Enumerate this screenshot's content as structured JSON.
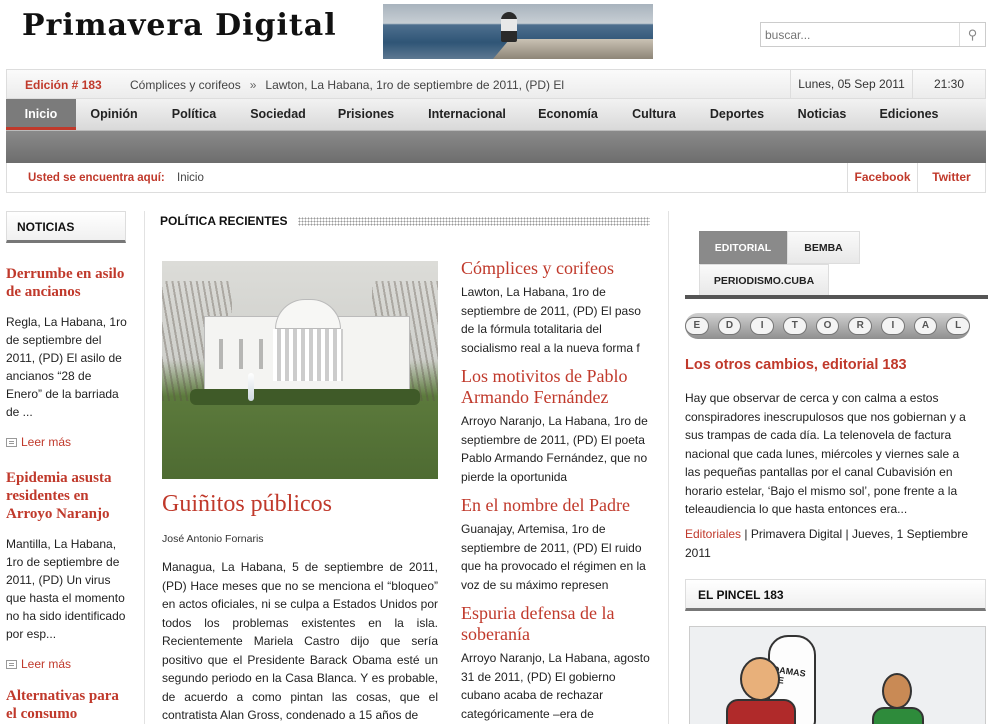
{
  "header": {
    "logo": "Primavera Digital",
    "search_placeholder": "buscar..."
  },
  "edition_bar": {
    "edition": "Edición # 183",
    "ticker_title": "Cómplices y corifeos",
    "ticker_sep": "»",
    "ticker_text": "Lawton, La Habana, 1ro de septiembre de 2011, (PD) El",
    "date": "Lunes, 05 Sep 2011",
    "time": "21:30"
  },
  "nav": {
    "items": [
      "Inicio",
      "Opinión",
      "Política",
      "Sociedad",
      "Prisiones",
      "Internacional",
      "Economía",
      "Cultura",
      "Deportes",
      "Noticias",
      "Ediciones"
    ],
    "active": "Inicio"
  },
  "location": {
    "label": "Usted se encuentra aquí:",
    "current": "Inicio",
    "facebook": "Facebook",
    "twitter": "Twitter"
  },
  "left": {
    "heading": "NOTICIAS",
    "read_more": "Leer más",
    "items": [
      {
        "title": "Derrumbe en asilo de ancianos",
        "text": "Regla, La Habana, 1ro de septiembre del 2011, (PD) El asilo de ancianos “28 de Enero” de la barriada de ..."
      },
      {
        "title": "Epidemia asusta residentes en Arroyo Naranjo",
        "text": "Mantilla, La Habana, 1ro de septiembre de 2011, (PD) Un virus que hasta el momento no ha sido identificado por esp..."
      },
      {
        "title": "Alternativas para el consumo familiar"
      }
    ]
  },
  "center": {
    "section_title": "POLÍTICA RECIENTES",
    "main_article": {
      "title": "Guiñitos públicos",
      "author": "José Antonio Fornaris",
      "body": "Managua, La Habana, 5 de septiembre de 2011, (PD) Hace meses que no se menciona el “bloqueo” en actos oficiales, ni se culpa a Estados Unidos por todos los problemas existentes en la isla. Recientemente Mariela Castro dijo que sería positivo que el Presidente Barack Obama esté un segundo periodo en la Casa Blanca. Y es probable, de acuerdo a como pintan las cosas, que el contratista Alan Gross, condenado a 15 años de"
    },
    "side_articles": [
      {
        "title": "Cómplices y corifeos",
        "text": "Lawton, La Habana, 1ro de septiembre de 2011, (PD) El paso de la fórmula totalitaria del socialismo real a la nueva forma f"
      },
      {
        "title": "Los motivitos de Pablo Armando Fernández",
        "text": "Arroyo Naranjo, La Habana, 1ro de septiembre de 2011, (PD) El poeta Pablo Armando Fernández, que no pierde la oportunida"
      },
      {
        "title": "En el nombre del Padre",
        "text": "Guanajay, Artemisa, 1ro de septiembre de 2011, (PD) El ruido que ha provocado el régimen en la voz de su máximo represen"
      },
      {
        "title": "Espuria defensa de la soberanía",
        "text": "Arroyo Naranjo, La Habana, agosto 31 de 2011, (PD) El gobierno cubano acaba de rechazar categóricamente –era de"
      }
    ]
  },
  "right": {
    "tabs": [
      "EDITORIAL",
      "BEMBA",
      "PERIODISMO.CUBA"
    ],
    "active_tab": "EDITORIAL",
    "badge_letters": [
      "E",
      "D",
      "I",
      "T",
      "O",
      "R",
      "I",
      "A",
      "L"
    ],
    "editorial_title": "Los otros cambios, editorial 183",
    "editorial_text": "Hay que observar de cerca y con calma a estos conspiradores inescrupulosos que nos gobiernan y a sus trampas de cada día. La telenovela de factura nacional que cada lunes, miércoles y viernes sale a las pequeñas pantallas por el canal Cubavisión en horario estelar, ‘Bajo el mismo sol’, pone frente a la teleaudiencia lo que hasta entonces era...",
    "meta_link": "Editoriales",
    "meta_rest": " | Primavera Digital | Jueves, 1 Septiembre 2011",
    "pincel_heading": "EL PINCEL 183",
    "cartoon_text": "DAMAS DE"
  },
  "colors": {
    "accent": "#c0392b",
    "nav_active": "#7b7b7b"
  }
}
